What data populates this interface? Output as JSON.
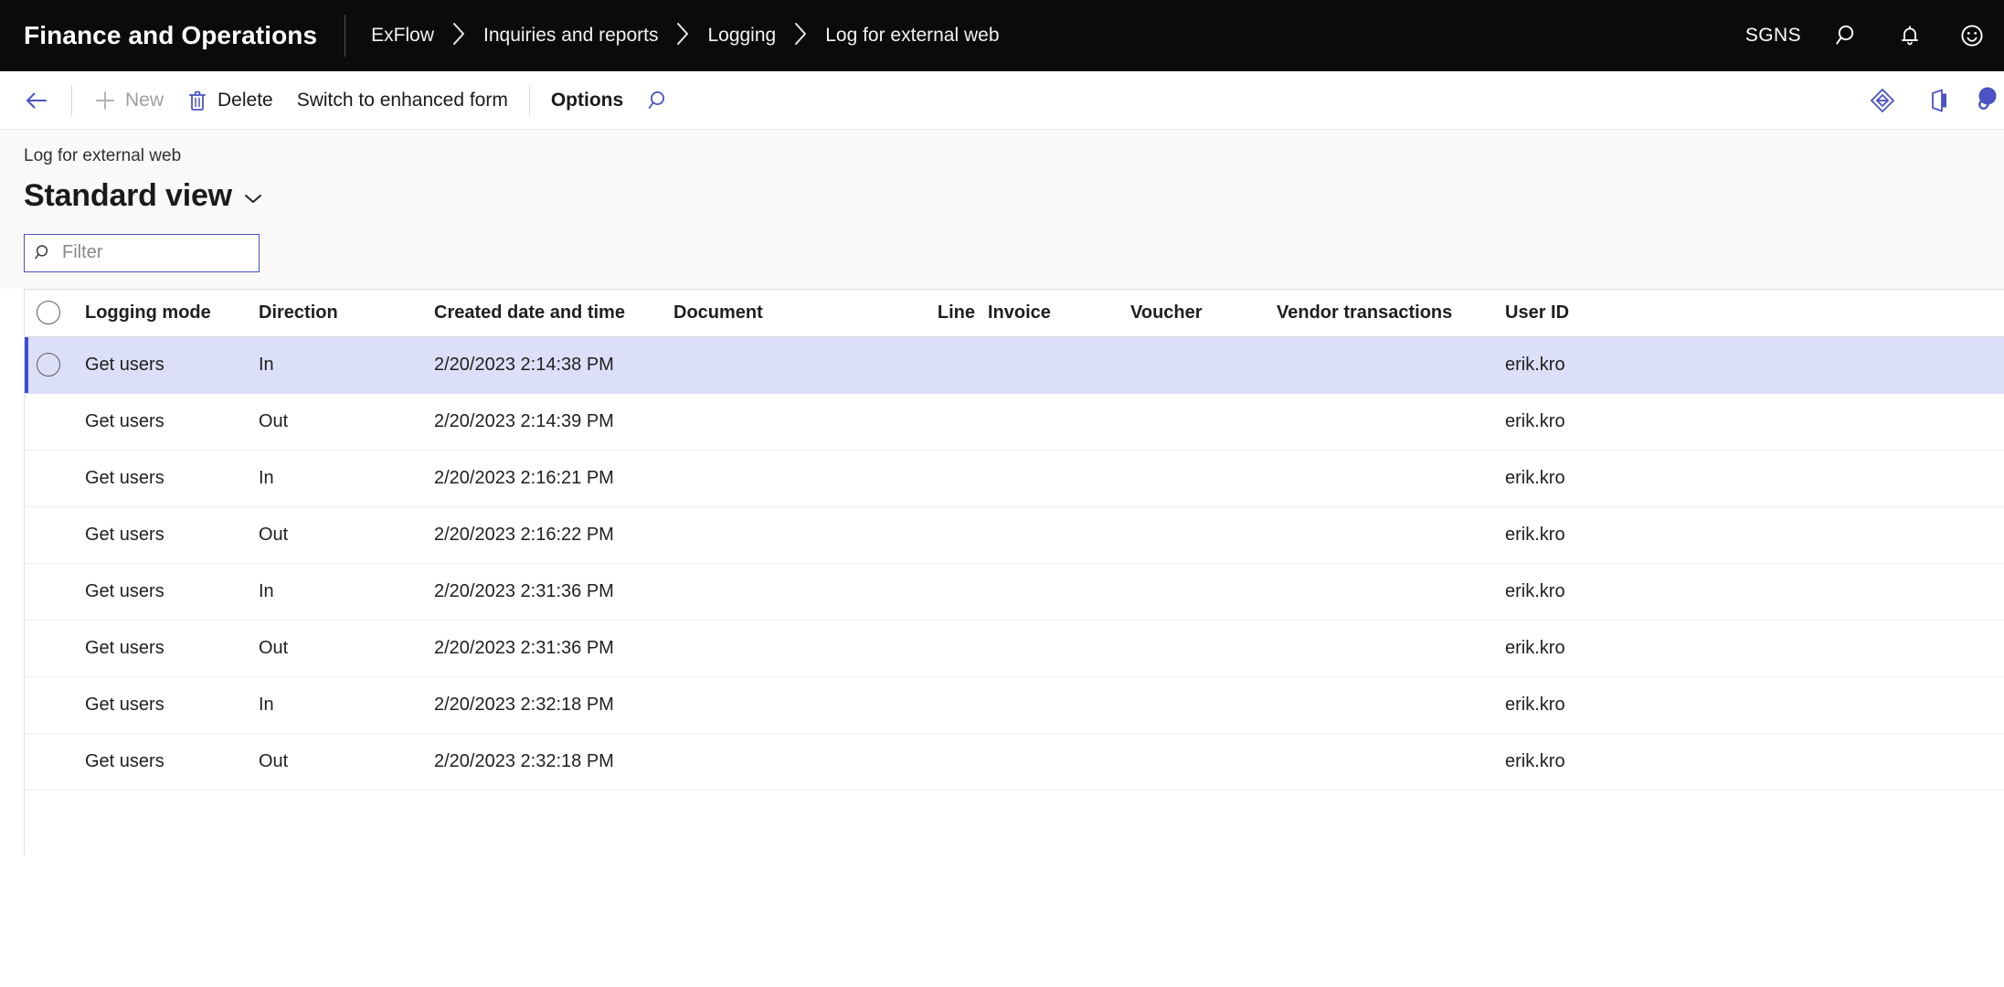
{
  "topbar": {
    "app_title": "Finance and Operations",
    "breadcrumb": [
      "ExFlow",
      "Inquiries and reports",
      "Logging",
      "Log for external web"
    ],
    "breadcrumb_separator": "›",
    "company": "SGNS",
    "icons": [
      "search-icon",
      "notifications-bell-icon",
      "help-smiley-icon"
    ]
  },
  "toolbar": {
    "back_label": "back-arrow",
    "new_label": "New",
    "delete_label": "Delete",
    "switch_label": "Switch to enhanced form",
    "options_label": "Options",
    "search_label": "search",
    "right_icons": [
      "personalize-diamond-icon",
      "office-app-icon",
      "attachments-icon"
    ]
  },
  "page": {
    "caption": "Log for external web",
    "view_title": "Standard view"
  },
  "filter": {
    "placeholder": "Filter",
    "value": ""
  },
  "grid": {
    "columns": {
      "logging_mode": "Logging mode",
      "direction": "Direction",
      "created": "Created date and time",
      "document": "Document",
      "line": "Line",
      "invoice": "Invoice",
      "voucher": "Voucher",
      "vendor_transactions": "Vendor transactions",
      "user_id": "User ID"
    },
    "rows": [
      {
        "logging_mode": "Get users",
        "direction": "In",
        "created": "2/20/2023 2:14:38 PM",
        "document": "",
        "line": "",
        "invoice": "",
        "voucher": "",
        "vendor_transactions": "",
        "user_id": "erik.kro",
        "selected": true
      },
      {
        "logging_mode": "Get users",
        "direction": "Out",
        "created": "2/20/2023 2:14:39 PM",
        "document": "",
        "line": "",
        "invoice": "",
        "voucher": "",
        "vendor_transactions": "",
        "user_id": "erik.kro",
        "selected": false
      },
      {
        "logging_mode": "Get users",
        "direction": "In",
        "created": "2/20/2023 2:16:21 PM",
        "document": "",
        "line": "",
        "invoice": "",
        "voucher": "",
        "vendor_transactions": "",
        "user_id": "erik.kro",
        "selected": false
      },
      {
        "logging_mode": "Get users",
        "direction": "Out",
        "created": "2/20/2023 2:16:22 PM",
        "document": "",
        "line": "",
        "invoice": "",
        "voucher": "",
        "vendor_transactions": "",
        "user_id": "erik.kro",
        "selected": false
      },
      {
        "logging_mode": "Get users",
        "direction": "In",
        "created": "2/20/2023 2:31:36 PM",
        "document": "",
        "line": "",
        "invoice": "",
        "voucher": "",
        "vendor_transactions": "",
        "user_id": "erik.kro",
        "selected": false
      },
      {
        "logging_mode": "Get users",
        "direction": "Out",
        "created": "2/20/2023 2:31:36 PM",
        "document": "",
        "line": "",
        "invoice": "",
        "voucher": "",
        "vendor_transactions": "",
        "user_id": "erik.kro",
        "selected": false
      },
      {
        "logging_mode": "Get users",
        "direction": "In",
        "created": "2/20/2023 2:32:18 PM",
        "document": "",
        "line": "",
        "invoice": "",
        "voucher": "",
        "vendor_transactions": "",
        "user_id": "erik.kro",
        "selected": false
      },
      {
        "logging_mode": "Get users",
        "direction": "Out",
        "created": "2/20/2023 2:32:18 PM",
        "document": "",
        "line": "",
        "invoice": "",
        "voucher": "",
        "vendor_transactions": "",
        "user_id": "erik.kro",
        "selected": false
      }
    ]
  },
  "colors": {
    "topbar_bg": "#0b0b0b",
    "accent": "#4b53c4",
    "selected_row_bg": "#dbe0f8",
    "selected_bar": "#3b4fd8"
  }
}
